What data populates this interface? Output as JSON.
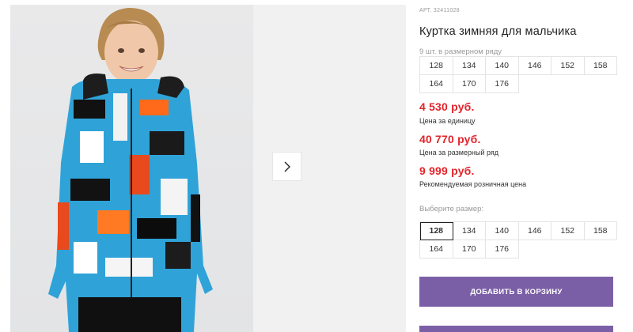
{
  "gallery": {
    "next_icon": "chevron-right-icon"
  },
  "product": {
    "article": "АРТ. 32411028",
    "title": "Куртка зимняя для мальчика",
    "row_note": "9 шт. в размерном ряду",
    "row_sizes": [
      "128",
      "134",
      "140",
      "146",
      "152",
      "158",
      "164",
      "170",
      "176"
    ],
    "prices": [
      {
        "value": "4 530 руб.",
        "label": "Цена за единицу"
      },
      {
        "value": "40 770 руб.",
        "label": "Цена за размерный ряд"
      },
      {
        "value": "9 999 руб.",
        "label": "Рекомендуемая розничная цена"
      }
    ],
    "choose_label": "Выберите размер:",
    "size_options": [
      "128",
      "134",
      "140",
      "146",
      "152",
      "158",
      "164",
      "170",
      "176"
    ],
    "selected_size": "128",
    "add_to_cart": "ДОБАВИТЬ В КОРЗИНУ"
  },
  "colors": {
    "price": "#e2242b",
    "button": "#7b5fa6"
  }
}
